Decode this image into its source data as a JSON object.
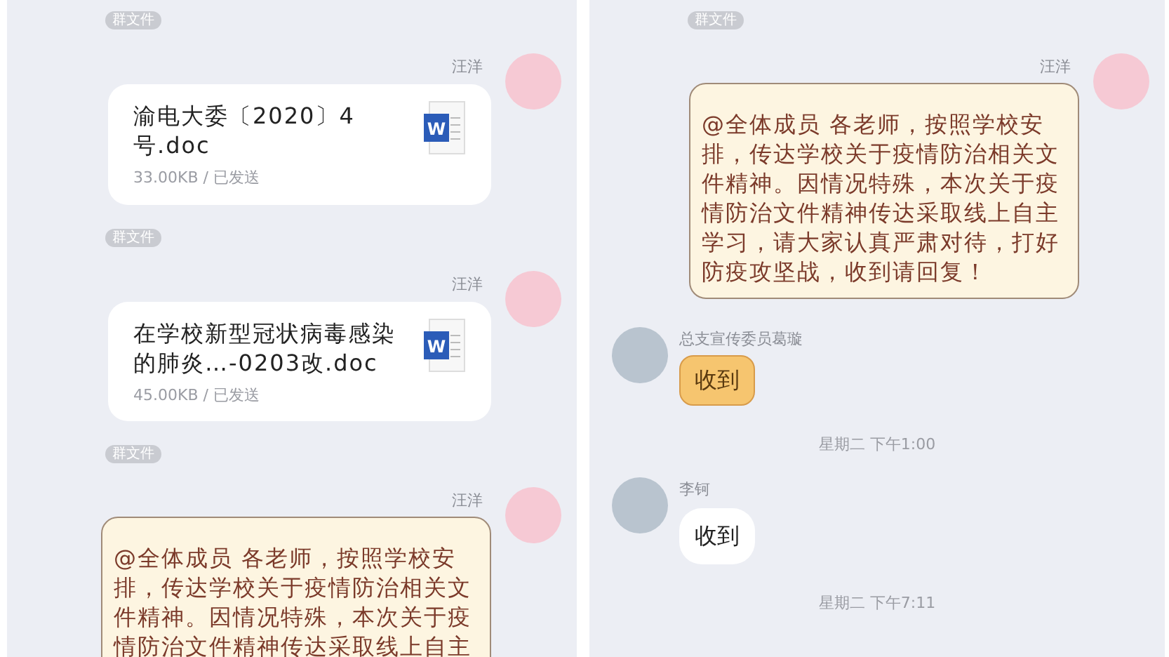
{
  "screens": [
    {
      "messages": [
        {
          "kind": "tag",
          "text": "群文件"
        },
        {
          "kind": "file",
          "outgoing": true,
          "sender": "汪洋",
          "file_name": "渝电大委〔2020〕4号.doc",
          "icon_label": "W",
          "meta": "33.00KB / 已发送"
        },
        {
          "kind": "tag",
          "text": "群文件"
        },
        {
          "kind": "file",
          "outgoing": true,
          "sender": "汪洋",
          "file_name": "在学校新型冠状病毒感染的肺炎…-0203改.doc",
          "icon_label": "W",
          "meta": "45.00KB / 已发送"
        },
        {
          "kind": "tag",
          "text": "群文件"
        },
        {
          "kind": "letter",
          "outgoing": true,
          "sender": "汪洋",
          "text": "@全体成员 各老师，按照学校安排，传达学校关于疫情防治相关文件精神。因情况特殊，本次关于疫情防治文件精神传达采取线上自主"
        }
      ]
    },
    {
      "messages": [
        {
          "kind": "tag",
          "text": "群文件"
        },
        {
          "kind": "letter",
          "outgoing": true,
          "sender": "汪洋",
          "text": "@全体成员 各老师，按照学校安排，传达学校关于疫情防治相关文件精神。因情况特殊，本次关于疫情防治文件精神传达采取线上自主学习，请大家认真严肃对待，打好防疫攻坚战，收到请回复！"
        },
        {
          "kind": "sticker",
          "outgoing": false,
          "sender": "总支宣传委员葛璇",
          "text": "收到"
        },
        {
          "kind": "time",
          "text": "星期二 下午1:00"
        },
        {
          "kind": "plain",
          "outgoing": false,
          "sender": "李钶",
          "text": "收到"
        },
        {
          "kind": "time",
          "text": "星期二 下午7:11"
        }
      ]
    }
  ]
}
